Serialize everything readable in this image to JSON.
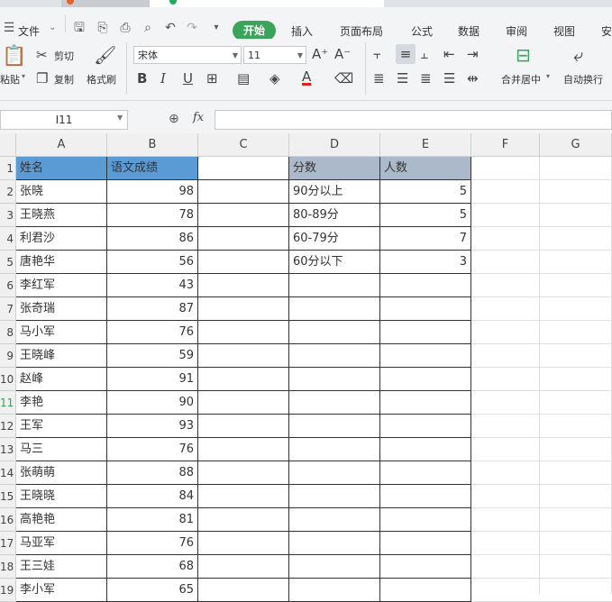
{
  "menu": {
    "file": "文件",
    "tabs": [
      "开始",
      "插入",
      "页面布局",
      "公式",
      "数据",
      "审阅",
      "视图",
      "安"
    ]
  },
  "ribbon": {
    "paste": "粘贴",
    "cut": "剪切",
    "copy": "复制",
    "format_painter": "格式刷",
    "font_name": "宋体",
    "font_size": "11",
    "merge_center": "合并居中",
    "wrap_text": "自动换行"
  },
  "formula_bar": {
    "name_box": "I11",
    "fx_label": "fx",
    "value": ""
  },
  "sheet": {
    "columns": [
      "A",
      "B",
      "C",
      "D",
      "E",
      "F",
      "G"
    ],
    "rows": [
      {
        "num": "1",
        "a": "姓名",
        "b": "语文成绩",
        "d": "分数",
        "e": "人数"
      },
      {
        "num": "2",
        "a": "张晓",
        "b": "98",
        "d": "90分以上",
        "e": "5"
      },
      {
        "num": "3",
        "a": "王晓燕",
        "b": "78",
        "d": "80-89分",
        "e": "5"
      },
      {
        "num": "4",
        "a": "利君沙",
        "b": "86",
        "d": "60-79分",
        "e": "7"
      },
      {
        "num": "5",
        "a": "唐艳华",
        "b": "56",
        "d": "60分以下",
        "e": "3"
      },
      {
        "num": "6",
        "a": "李红军",
        "b": "43",
        "d": "",
        "e": ""
      },
      {
        "num": "7",
        "a": "张奇瑞",
        "b": "87",
        "d": "",
        "e": ""
      },
      {
        "num": "8",
        "a": "马小军",
        "b": "76",
        "d": "",
        "e": ""
      },
      {
        "num": "9",
        "a": "王晓峰",
        "b": "59",
        "d": "",
        "e": ""
      },
      {
        "num": "10",
        "a": "赵峰",
        "b": "91",
        "d": "",
        "e": ""
      },
      {
        "num": "11",
        "a": "李艳",
        "b": "90",
        "d": "",
        "e": ""
      },
      {
        "num": "12",
        "a": "王军",
        "b": "93",
        "d": "",
        "e": ""
      },
      {
        "num": "13",
        "a": "马三",
        "b": "76",
        "d": "",
        "e": ""
      },
      {
        "num": "14",
        "a": "张萌萌",
        "b": "88",
        "d": "",
        "e": ""
      },
      {
        "num": "15",
        "a": "王晓晓",
        "b": "84",
        "d": "",
        "e": ""
      },
      {
        "num": "16",
        "a": "高艳艳",
        "b": "81",
        "d": "",
        "e": ""
      },
      {
        "num": "17",
        "a": "马亚军",
        "b": "76",
        "d": "",
        "e": ""
      },
      {
        "num": "18",
        "a": "王三娃",
        "b": "68",
        "d": "",
        "e": ""
      },
      {
        "num": "19",
        "a": "李小军",
        "b": "65",
        "d": "",
        "e": ""
      }
    ]
  },
  "colors": {
    "header_blue": "#5b9bd5",
    "header_gray": "#acb9ca",
    "accent_green": "#3aa45b"
  }
}
